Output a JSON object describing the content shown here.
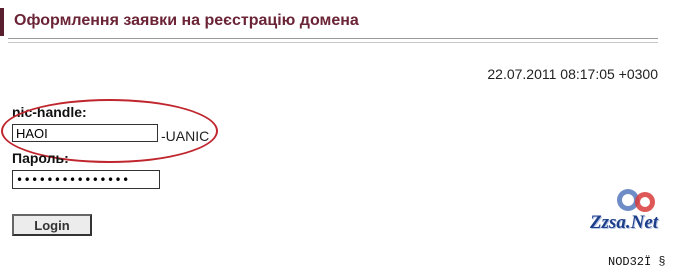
{
  "page": {
    "title": "Оформлення заявки на реєстрацію домена"
  },
  "timestamp": "22.07.2011 08:17:05 +0300",
  "form": {
    "nic_label": "nic-handle:",
    "nic_value": "HAOI",
    "nic_suffix": "-UANIC",
    "password_label": "Пароль:",
    "password_value": "mypassword12345",
    "login_label": "Login"
  },
  "annotation": {
    "color": "#c0262e"
  },
  "watermark": {
    "site": "Zzsa.Net",
    "tag": "NOD32Ï §"
  },
  "colors": {
    "title": "#6b2436",
    "accent": "#5a1f2e"
  }
}
